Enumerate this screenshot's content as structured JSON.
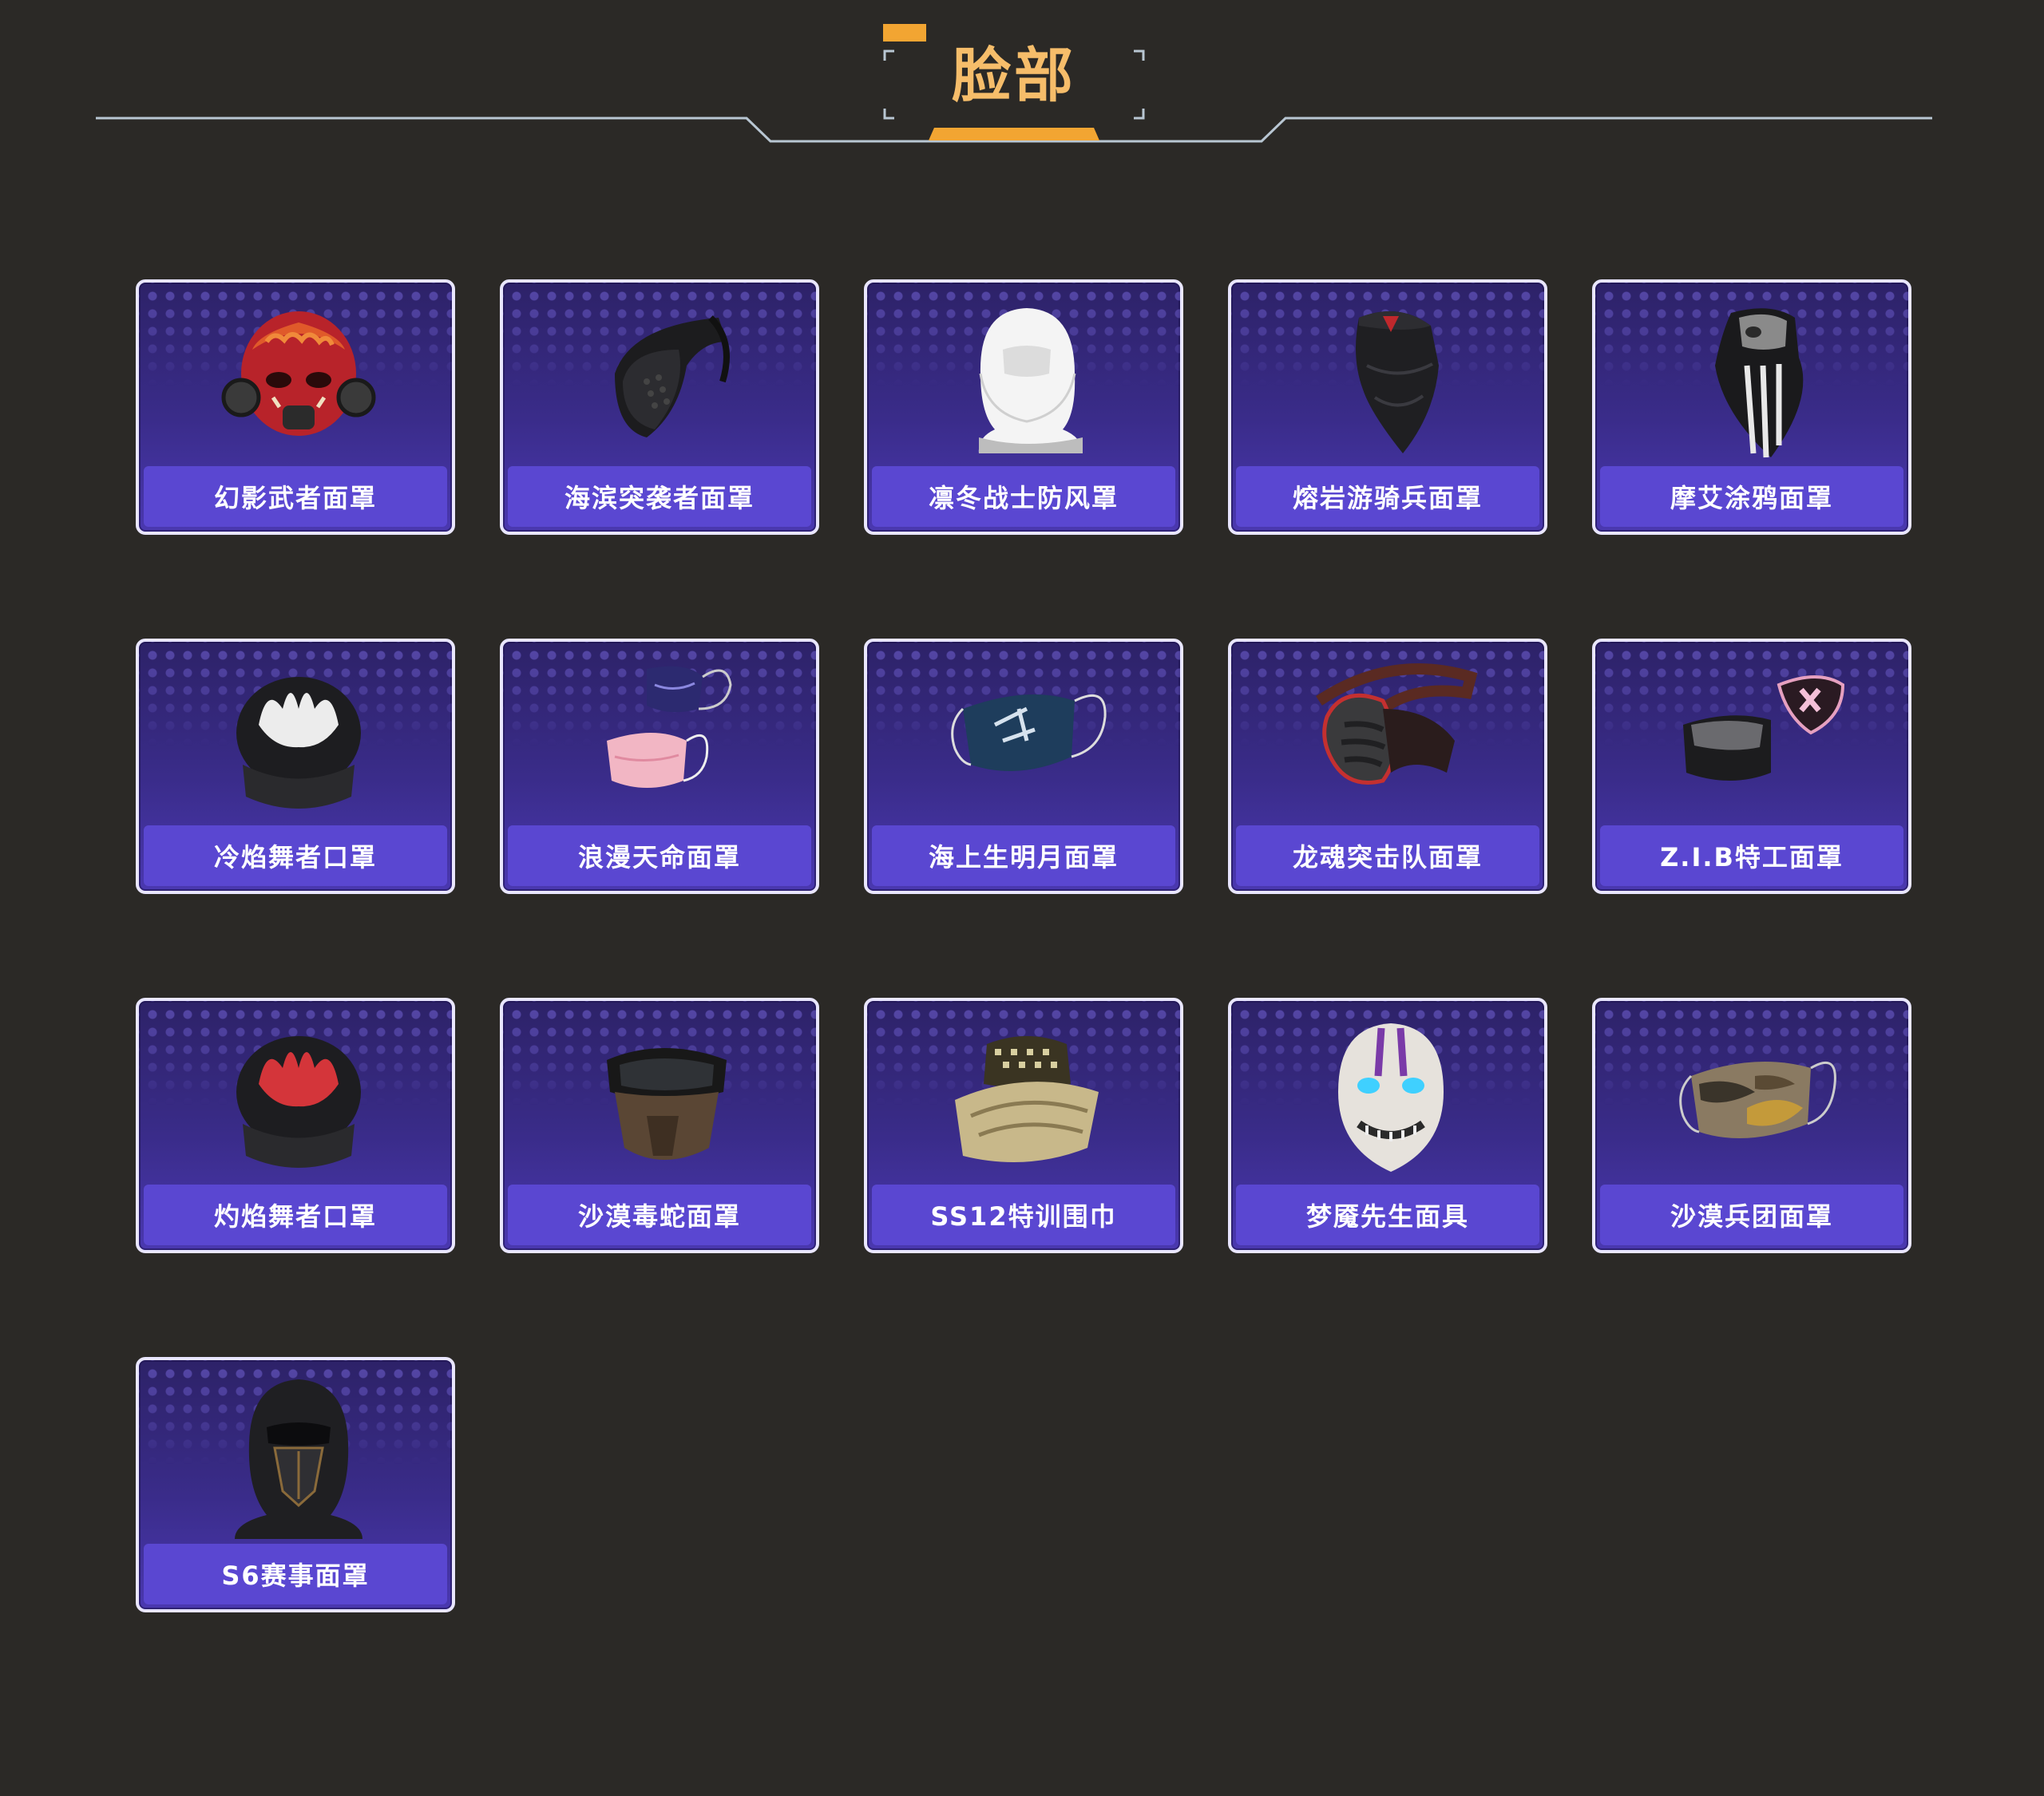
{
  "header": {
    "title": "脸部"
  },
  "colors": {
    "background": "#2b2926",
    "accent": "#f6bd6a",
    "accent_bar": "#f2a532",
    "card_border": "#e9e6ff",
    "label_bar": "#5a47d1"
  },
  "items": [
    {
      "name": "幻影武者面罩",
      "icon": "red-oni-gas-mask-icon"
    },
    {
      "name": "海滨突袭者面罩",
      "icon": "black-half-face-mask-icon"
    },
    {
      "name": "凛冬战士防风罩",
      "icon": "white-balaclava-icon"
    },
    {
      "name": "熔岩游骑兵面罩",
      "icon": "black-bandana-mask-icon"
    },
    {
      "name": "摩艾涂鸦面罩",
      "icon": "striped-bandana-mask-icon"
    },
    {
      "name": "冷焰舞者口罩",
      "icon": "white-flame-neck-gaiter-icon"
    },
    {
      "name": "浪漫天命面罩",
      "icon": "purple-pink-cloth-masks-icon"
    },
    {
      "name": "海上生明月面罩",
      "icon": "blue-cloth-mask-icon"
    },
    {
      "name": "龙魂突击队面罩",
      "icon": "red-tactical-mask-icon"
    },
    {
      "name": "Z.I.B特工面罩",
      "icon": "gaiter-with-patch-icon"
    },
    {
      "name": "灼焰舞者口罩",
      "icon": "red-flame-neck-gaiter-icon"
    },
    {
      "name": "沙漠毒蛇面罩",
      "icon": "goggles-tactical-mask-icon"
    },
    {
      "name": "SS12特训围巾",
      "icon": "shemagh-scarf-icon"
    },
    {
      "name": "梦魇先生面具",
      "icon": "nightmare-face-mask-icon"
    },
    {
      "name": "沙漠兵团面罩",
      "icon": "camo-cloth-mask-icon"
    },
    {
      "name": "S6赛事面罩",
      "icon": "black-ninja-hood-icon"
    }
  ]
}
